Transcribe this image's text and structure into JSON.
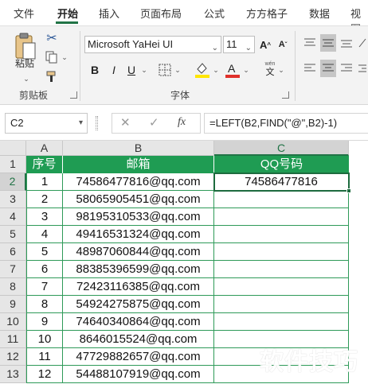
{
  "ribbon_tabs": [
    "文件",
    "开始",
    "插入",
    "页面布局",
    "公式",
    "方方格子",
    "数据",
    "视图"
  ],
  "active_tab": "开始",
  "clipboard": {
    "paste_label": "粘贴",
    "group_label": "剪贴板"
  },
  "font": {
    "name": "Microsoft YaHei UI",
    "size": "11",
    "group_label": "字体",
    "bold": "B",
    "italic": "I",
    "underline": "U",
    "wen_label": "wén",
    "wen_char": "文"
  },
  "name_box": "C2",
  "formula": "=LEFT(B2,FIND(\"@\",B2)-1)",
  "fx_label": "fx",
  "columns": [
    "A",
    "B",
    "C"
  ],
  "row_numbers": [
    "1",
    "2",
    "3",
    "4",
    "5",
    "6",
    "7",
    "8",
    "9",
    "10",
    "11",
    "12",
    "13"
  ],
  "table_headers": [
    "序号",
    "邮箱",
    "QQ号码"
  ],
  "rows": [
    {
      "no": "1",
      "email": "74586477816@qq.com",
      "qq": "74586477816"
    },
    {
      "no": "2",
      "email": "58065905451@qq.com",
      "qq": ""
    },
    {
      "no": "3",
      "email": "98195310533@qq.com",
      "qq": ""
    },
    {
      "no": "4",
      "email": "49416531324@qq.com",
      "qq": ""
    },
    {
      "no": "5",
      "email": "48987060844@qq.com",
      "qq": ""
    },
    {
      "no": "6",
      "email": "88385396599@qq.com",
      "qq": ""
    },
    {
      "no": "7",
      "email": "72423116385@qq.com",
      "qq": ""
    },
    {
      "no": "8",
      "email": "54924275875@qq.com",
      "qq": ""
    },
    {
      "no": "9",
      "email": "74640340864@qq.com",
      "qq": ""
    },
    {
      "no": "10",
      "email": "8646015524@qq.com",
      "qq": ""
    },
    {
      "no": "11",
      "email": "47729882657@qq.com",
      "qq": ""
    },
    {
      "no": "12",
      "email": "54488107919@qq.com",
      "qq": ""
    }
  ],
  "watermark": "软件技巧",
  "colors": {
    "accent": "#217346",
    "header_fill": "#1f9c53",
    "border": "#2e9a58",
    "font_color_bar": "#e0312b",
    "highlight_bar": "#ffe600"
  }
}
